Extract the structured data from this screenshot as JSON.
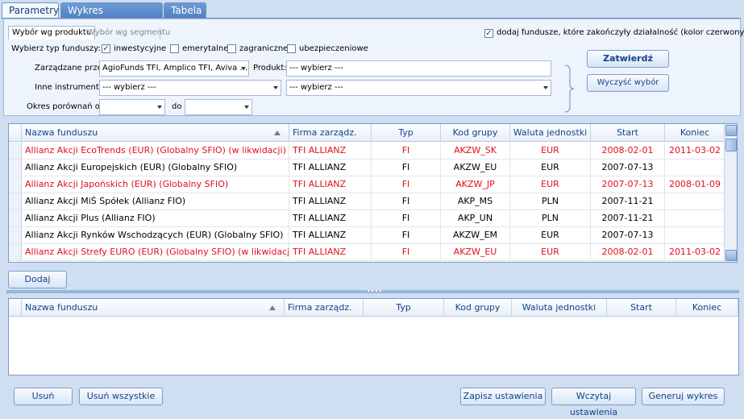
{
  "tabs": [
    {
      "label": "Parametry"
    },
    {
      "label": "Wykres porównawczy"
    },
    {
      "label": "Tabela"
    }
  ],
  "filters": {
    "subtabs": [
      {
        "label": "Wybór wg produktu"
      },
      {
        "label": "Wybór wg segmentu"
      }
    ],
    "include_closed_label": "dodaj fundusze, które zakończyły działalność (kolor czerwony)",
    "fund_type_label": "Wybierz typ funduszy:",
    "fund_types": [
      {
        "label": "inwestycyjne",
        "checked": true
      },
      {
        "label": "emerytalne",
        "checked": false
      },
      {
        "label": "zagraniczne",
        "checked": false
      },
      {
        "label": "ubezpieczeniowe",
        "checked": false
      }
    ],
    "managed_by_label": "Zarządzane przez:",
    "managed_by_value": "AgioFunds TFI, Amplico TFI, Aviva ...",
    "product_label": "Produkt:",
    "product_value": "--- wybierz ---",
    "other_instruments_label": "Inne instrumenty:",
    "other_instruments_value": "--- wybierz ---",
    "other_instruments_value2": "--- wybierz ---",
    "period_from_label": "Okres porównań od:",
    "period_from_value": "",
    "period_to_label": "do",
    "period_to_value": "",
    "confirm_label": "Zatwierdź",
    "clear_label": "Wyczyść wybór"
  },
  "columns": [
    "Nazwa funduszu",
    "Firma zarządz.",
    "Typ",
    "Kod grupy",
    "Waluta jednostki",
    "Start",
    "Koniec"
  ],
  "funds": [
    {
      "name": "Allianz Akcji EcoTrends (EUR) (Globalny SFIO) (w likwidacji)",
      "company": "TFI ALLIANZ",
      "type": "FI",
      "group": "AKZW_SK",
      "currency": "EUR",
      "start": "2008-02-01",
      "end": "2011-03-02",
      "closed": true
    },
    {
      "name": "Allianz Akcji Europejskich (EUR) (Globalny SFIO)",
      "company": "TFI ALLIANZ",
      "type": "FI",
      "group": "AKZW_EU",
      "currency": "EUR",
      "start": "2007-07-13",
      "end": "",
      "closed": false
    },
    {
      "name": "Allianz Akcji Japońskich (EUR) (Globalny SFIO)",
      "company": "TFI ALLIANZ",
      "type": "FI",
      "group": "AKZW_JP",
      "currency": "EUR",
      "start": "2007-07-13",
      "end": "2008-01-09",
      "closed": true
    },
    {
      "name": "Allianz Akcji MiŚ Spółek (Allianz FIO)",
      "company": "TFI ALLIANZ",
      "type": "FI",
      "group": "AKP_MS",
      "currency": "PLN",
      "start": "2007-11-21",
      "end": "",
      "closed": false
    },
    {
      "name": "Allianz Akcji Plus (Allianz FIO)",
      "company": "TFI ALLIANZ",
      "type": "FI",
      "group": "AKP_UN",
      "currency": "PLN",
      "start": "2007-11-21",
      "end": "",
      "closed": false
    },
    {
      "name": "Allianz Akcji Rynków Wschodzących (EUR) (Globalny SFIO)",
      "company": "TFI ALLIANZ",
      "type": "FI",
      "group": "AKZW_EM",
      "currency": "EUR",
      "start": "2007-07-13",
      "end": "",
      "closed": false
    },
    {
      "name": "Allianz Akcji Strefy EURO (EUR) (Globalny SFIO) (w likwidacji)",
      "company": "TFI ALLIANZ",
      "type": "FI",
      "group": "AKZW_EU",
      "currency": "EUR",
      "start": "2008-02-01",
      "end": "2011-03-02",
      "closed": true
    }
  ],
  "add_label": "Dodaj",
  "bottom_buttons": {
    "remove": "Usuń",
    "remove_all": "Usuń wszystkie",
    "save_settings": "Zapisz ustawienia",
    "load_settings": "Wczytaj ustawienia",
    "generate_chart": "Generuj wykres"
  }
}
